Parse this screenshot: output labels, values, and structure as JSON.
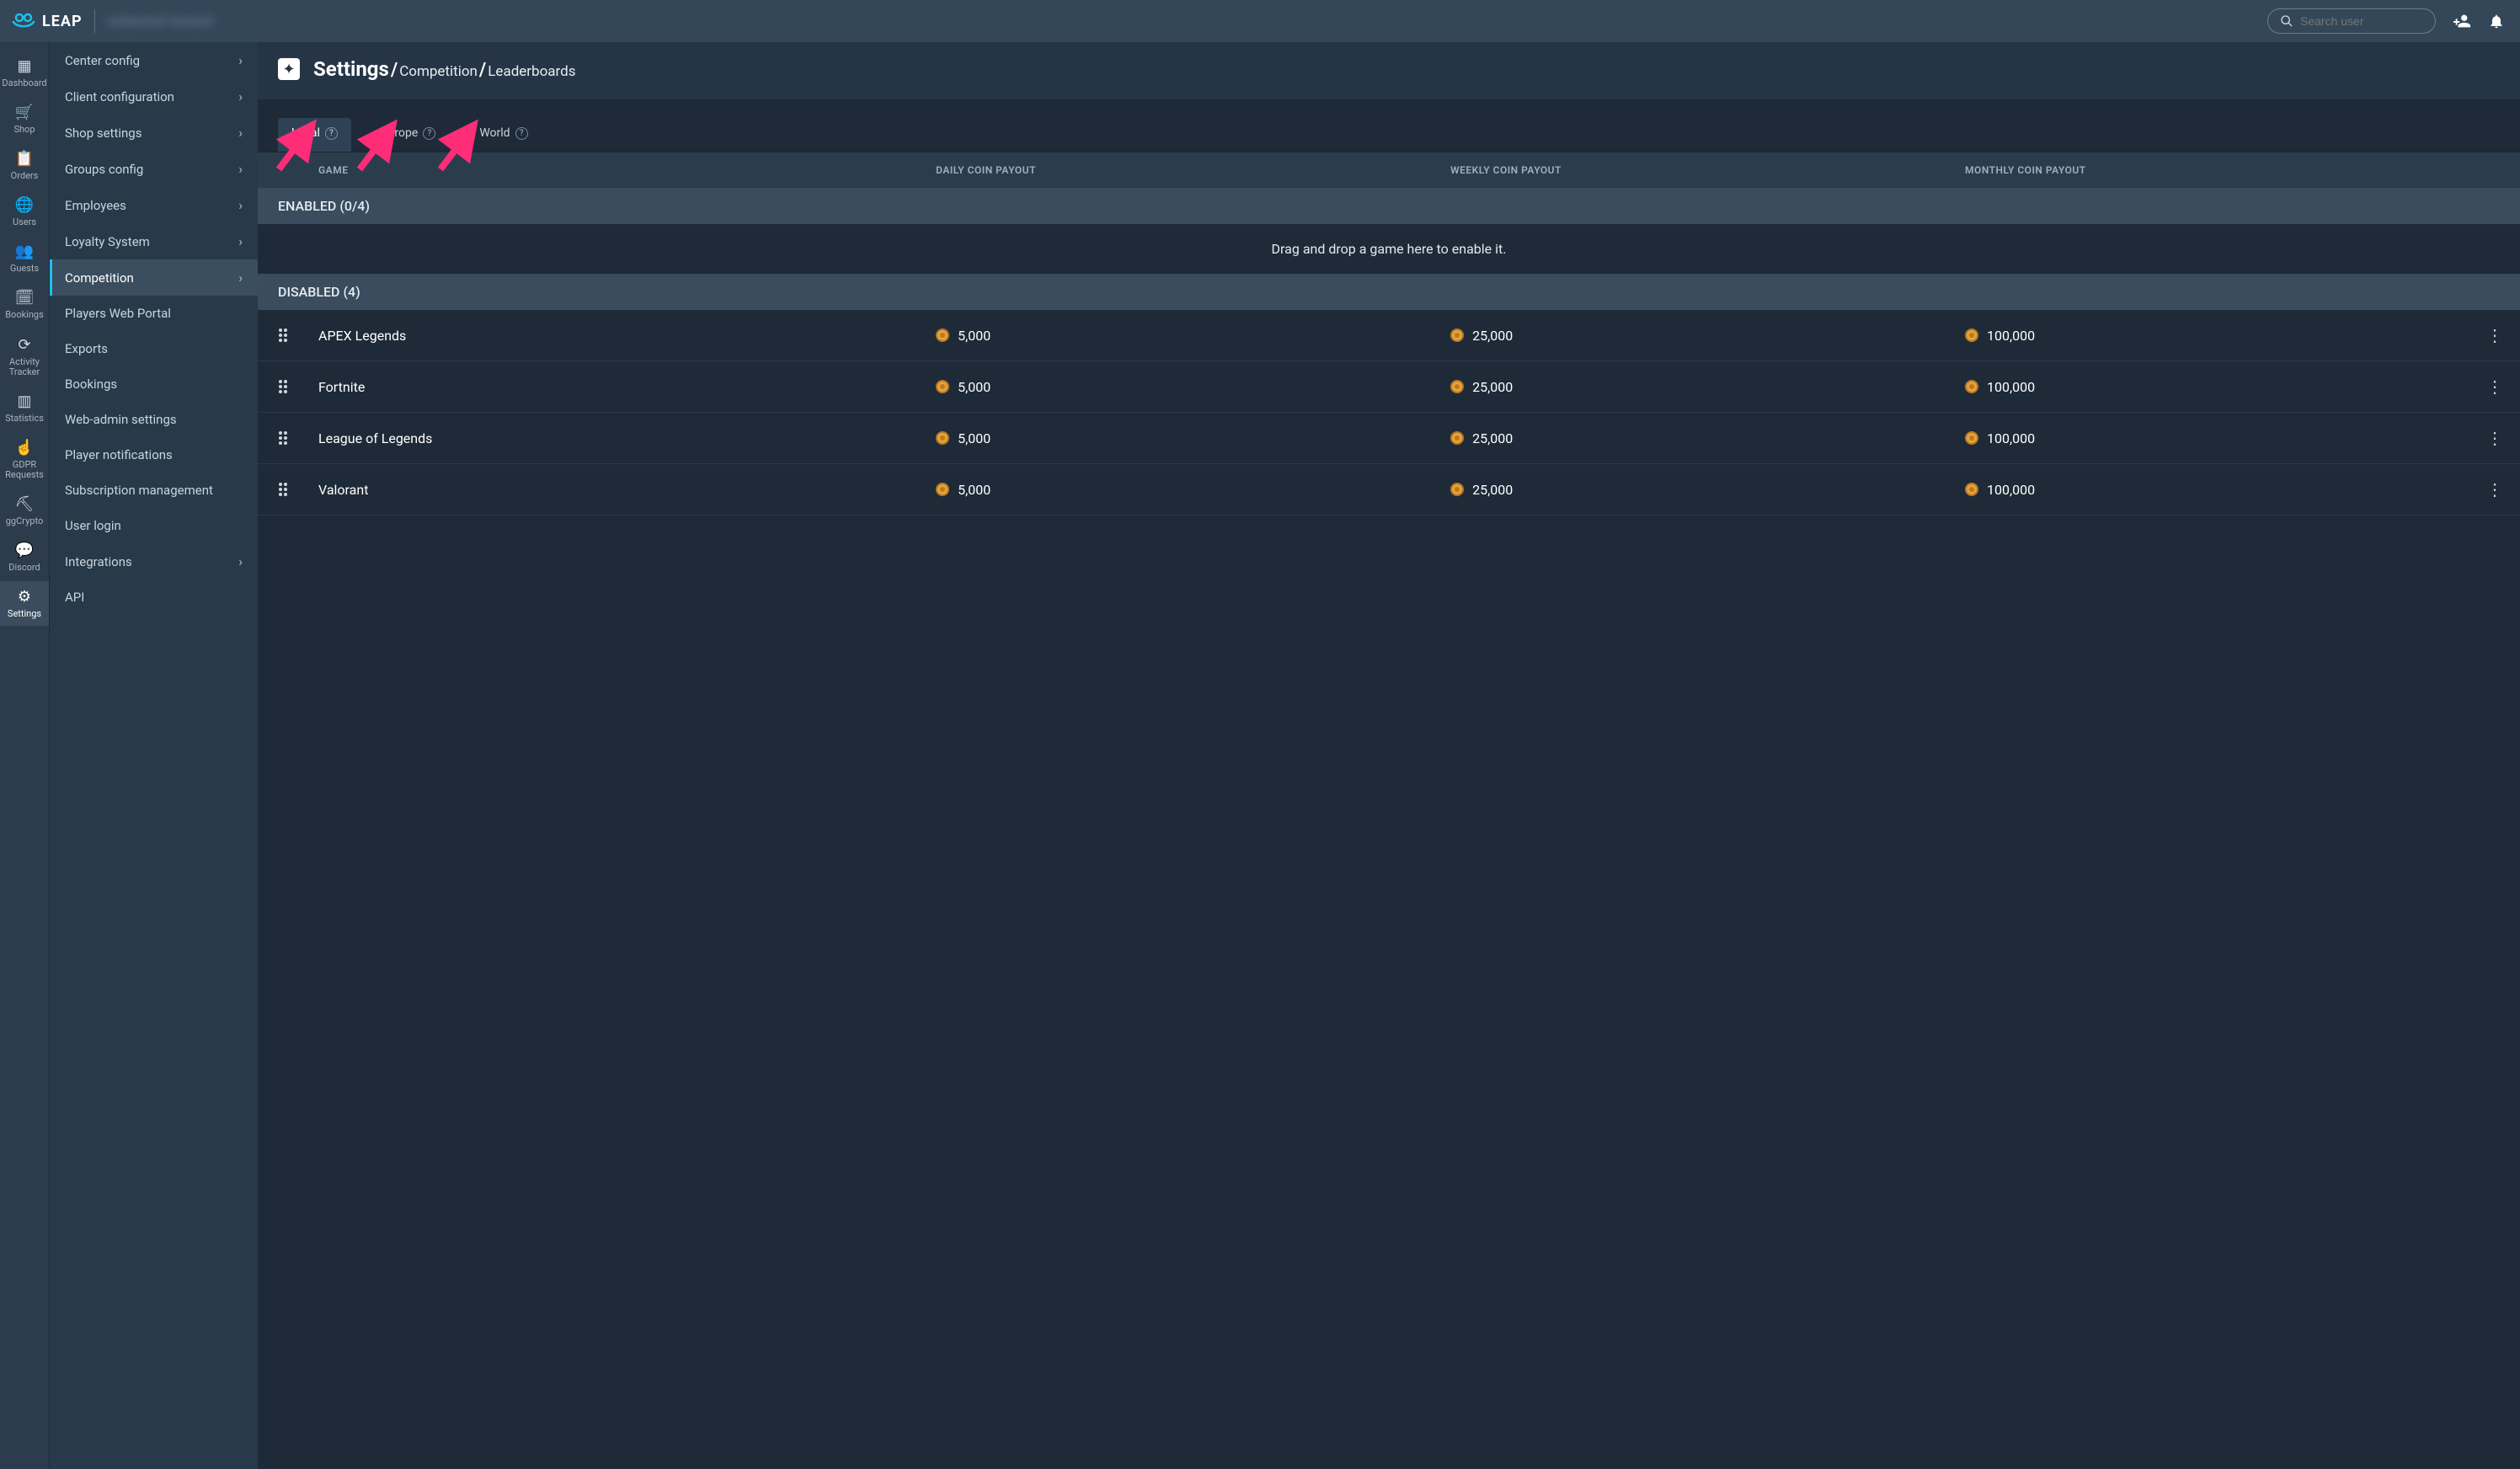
{
  "brand": {
    "name": "LEAP",
    "tenant_placeholder": "redacted tenant"
  },
  "topbar": {
    "search_placeholder": "Search user"
  },
  "rail": {
    "items": [
      {
        "id": "dashboard",
        "label": "Dashboard",
        "glyph": "▦"
      },
      {
        "id": "shop",
        "label": "Shop",
        "glyph": "🛒"
      },
      {
        "id": "orders",
        "label": "Orders",
        "glyph": "📋"
      },
      {
        "id": "users",
        "label": "Users",
        "glyph": "🌐"
      },
      {
        "id": "guests",
        "label": "Guests",
        "glyph": "👥"
      },
      {
        "id": "bookings",
        "label": "Bookings",
        "glyph": "🗓"
      },
      {
        "id": "activity",
        "label": "Activity Tracker",
        "glyph": "⟳"
      },
      {
        "id": "statistics",
        "label": "Statistics",
        "glyph": "▥"
      },
      {
        "id": "gdpr",
        "label": "GDPR Requests",
        "glyph": "☝"
      },
      {
        "id": "ggcrypto",
        "label": "ggCrypto",
        "glyph": "⛏"
      },
      {
        "id": "discord",
        "label": "Discord",
        "glyph": "💬"
      },
      {
        "id": "settings",
        "label": "Settings",
        "glyph": "⚙",
        "active": true
      }
    ]
  },
  "sidebar": {
    "items": [
      {
        "label": "Center config",
        "chevron": true
      },
      {
        "label": "Client configuration",
        "chevron": true
      },
      {
        "label": "Shop settings",
        "chevron": true
      },
      {
        "label": "Groups config",
        "chevron": true
      },
      {
        "label": "Employees",
        "chevron": true
      },
      {
        "label": "Loyalty System",
        "chevron": true
      },
      {
        "label": "Competition",
        "chevron": true,
        "active": true
      },
      {
        "label": "Players Web Portal"
      },
      {
        "label": "Exports"
      },
      {
        "label": "Bookings"
      },
      {
        "label": "Web-admin settings"
      },
      {
        "label": "Player notifications"
      },
      {
        "label": "Subscription management"
      },
      {
        "label": "User login"
      },
      {
        "label": "Integrations",
        "chevron": true
      },
      {
        "label": "API"
      }
    ]
  },
  "header": {
    "root": "Settings",
    "crumb1": "Competition",
    "crumb2": "Leaderboards"
  },
  "tabs": [
    {
      "id": "local",
      "label": "Local",
      "active": true
    },
    {
      "id": "europe",
      "label": "Europe"
    },
    {
      "id": "world",
      "label": "World"
    }
  ],
  "columns": {
    "game": "GAME",
    "daily": "DAILY COIN PAYOUT",
    "weekly": "WEEKLY COIN PAYOUT",
    "monthly": "MONTHLY COIN PAYOUT"
  },
  "groups": {
    "enabled_label": "ENABLED (0/4)",
    "disabled_label": "DISABLED (4)",
    "empty_hint": "Drag and drop a game here to enable it."
  },
  "disabled_games": [
    {
      "name": "APEX Legends",
      "daily": "5,000",
      "weekly": "25,000",
      "monthly": "100,000"
    },
    {
      "name": "Fortnite",
      "daily": "5,000",
      "weekly": "25,000",
      "monthly": "100,000"
    },
    {
      "name": "League of Legends",
      "daily": "5,000",
      "weekly": "25,000",
      "monthly": "100,000"
    },
    {
      "name": "Valorant",
      "daily": "5,000",
      "weekly": "25,000",
      "monthly": "100,000"
    }
  ],
  "annotation": {
    "color": "#ff2d78"
  }
}
